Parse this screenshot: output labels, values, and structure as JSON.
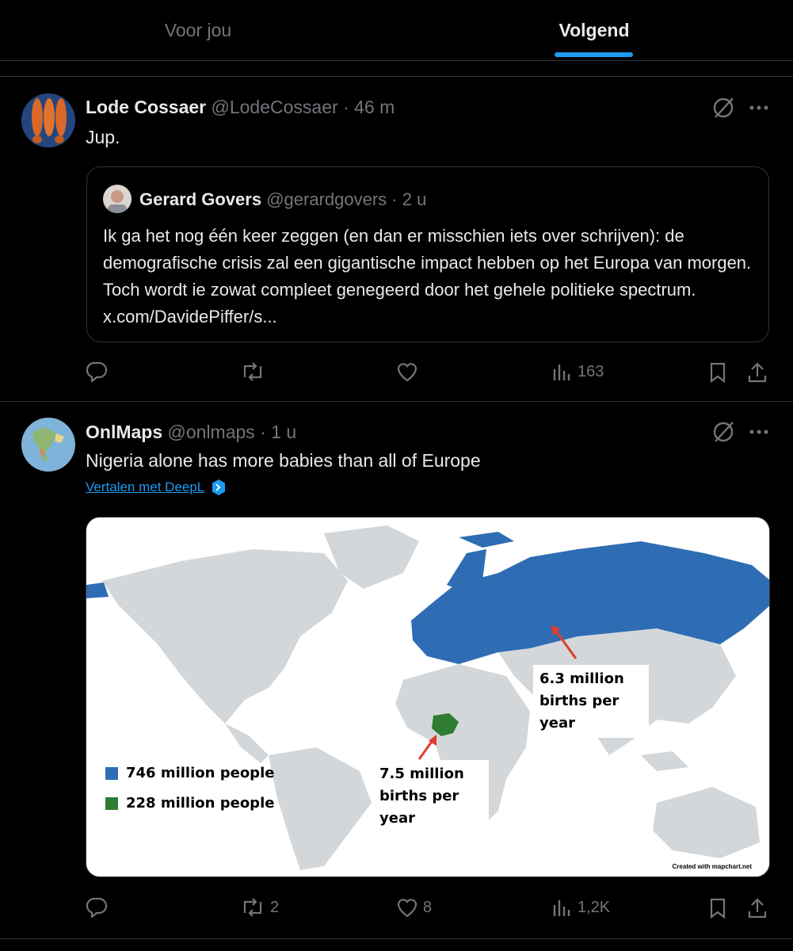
{
  "tabs": [
    {
      "label": "Voor jou",
      "active": false
    },
    {
      "label": "Volgend",
      "active": true
    }
  ],
  "accent_color": "#1d9bf0",
  "posts": [
    {
      "author_name": "Lode Cossaer",
      "handle": "@LodeCossaer",
      "time": "· 46 m",
      "text": "Jup.",
      "quote": {
        "author_name": "Gerard Govers",
        "handle": "@gerardgovers",
        "time": "· 2 u",
        "text": "Ik ga het nog één keer zeggen (en dan er misschien iets over schrijven): de demografische crisis zal een gigantische impact hebben op het Europa van morgen. Toch wordt ie zowat compleet genegeerd door het gehele politieke spectrum. x.com/DavidePiffer/s..."
      },
      "stats": {
        "replies": "",
        "reposts": "",
        "likes": "",
        "views": "163"
      }
    },
    {
      "author_name": "OnlMaps",
      "handle": "@onlmaps",
      "time": "· 1 u",
      "text": "Nigeria alone has more babies than all of Europe",
      "translate_label": "Vertalen met DeepL",
      "media": {
        "legend": [
          {
            "label": "746 million people",
            "color": "#2e6db4"
          },
          {
            "label": "228 million people",
            "color": "#2e7d32"
          }
        ],
        "callouts": [
          "6.3 million births per year",
          "7.5 million births per year"
        ],
        "credit": "Created with mapchart.net"
      },
      "stats": {
        "replies": "",
        "reposts": "2",
        "likes": "8",
        "views": "1,2K"
      }
    }
  ]
}
